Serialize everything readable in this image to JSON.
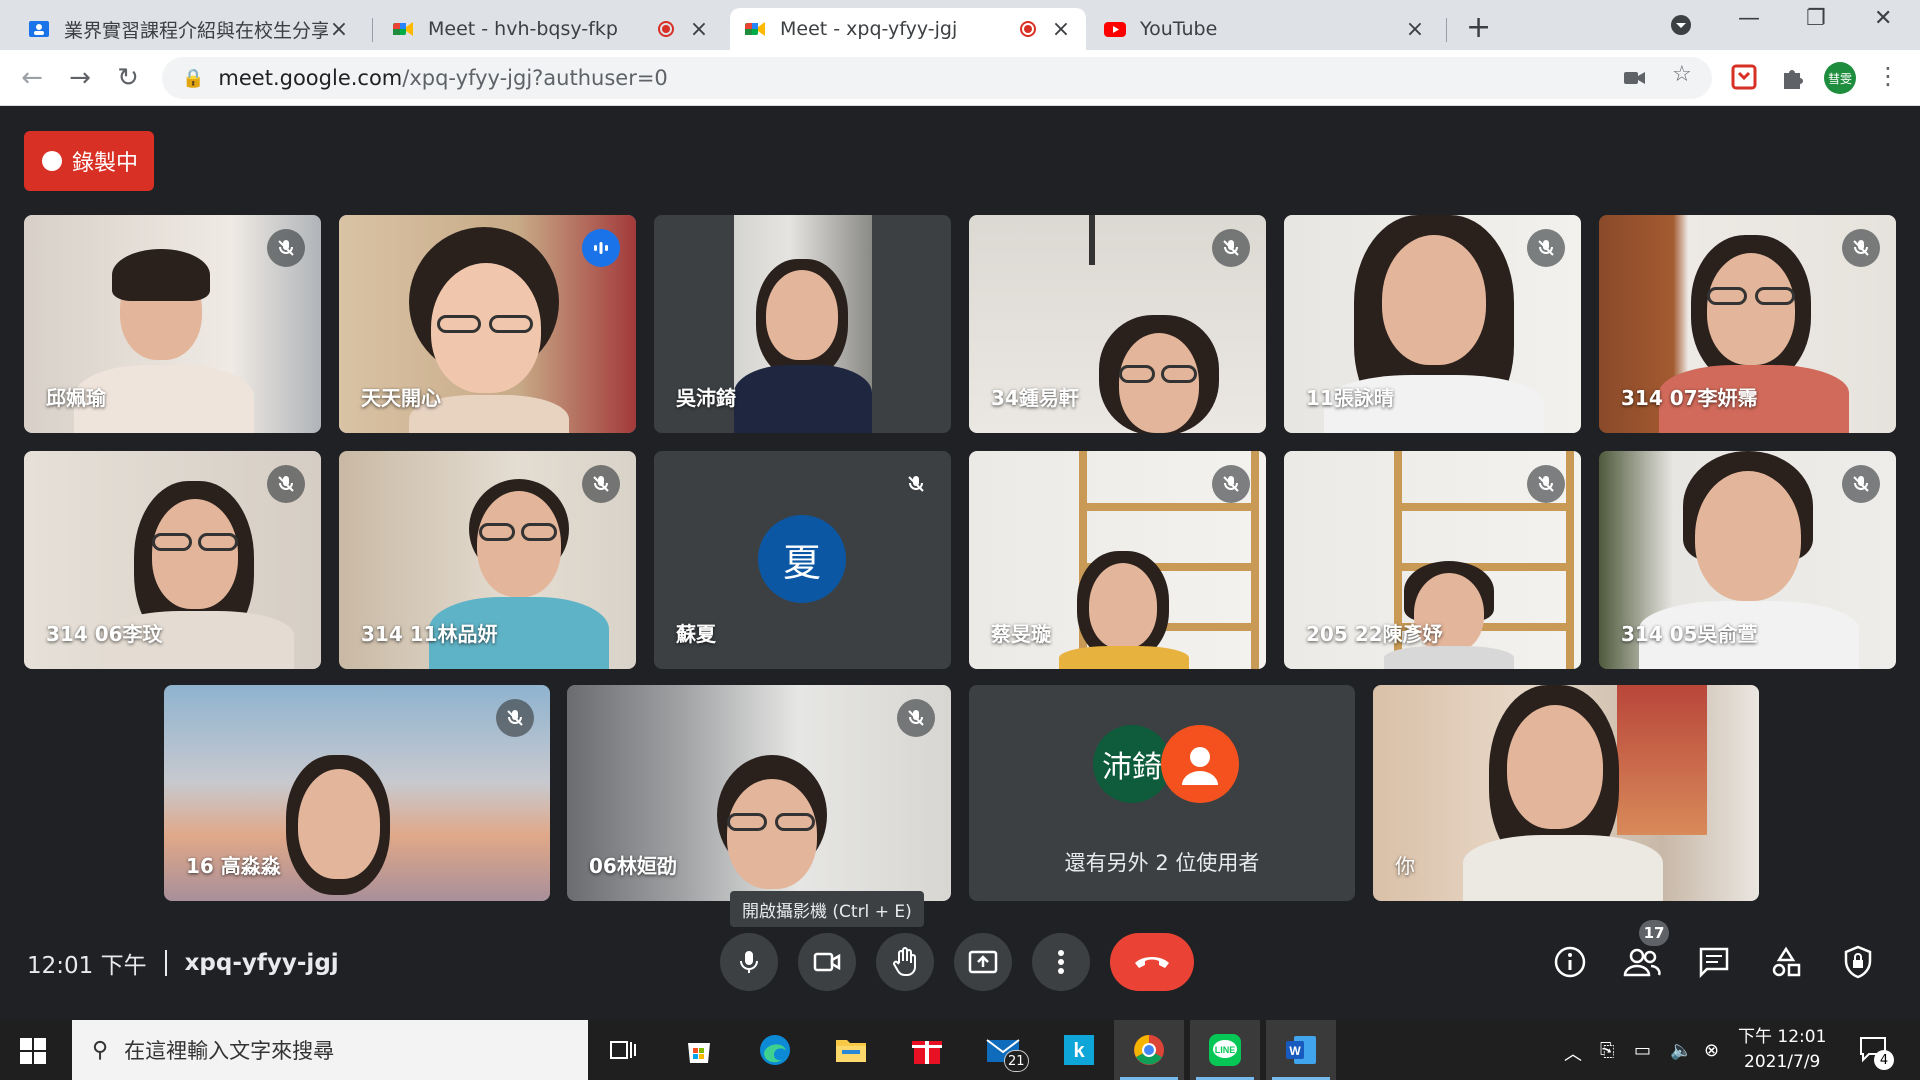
{
  "browser": {
    "tabs": [
      {
        "title": "業界實習課程介紹與在校生分享",
        "favicon": "classroom-icon",
        "active": false,
        "recording": false
      },
      {
        "title": "Meet - hvh-bqsy-fkp",
        "favicon": "meet-icon",
        "active": false,
        "recording": true
      },
      {
        "title": "Meet - xpq-yfyy-jgj",
        "favicon": "meet-icon",
        "active": true,
        "recording": true
      },
      {
        "title": "YouTube",
        "favicon": "youtube-icon",
        "active": false,
        "recording": false
      }
    ],
    "url_host": "meet.google.com",
    "url_path": "/xpq-yfyy-jgj?authuser=0",
    "profile_label": "彗雯"
  },
  "meet": {
    "recording_label": "錄製中",
    "participants": [
      {
        "name": "邱姵瑜",
        "muted": true
      },
      {
        "name": "天天開心",
        "muted": false,
        "speaking": true
      },
      {
        "name": "吳沛錡",
        "muted": false
      },
      {
        "name": "34鍾易軒",
        "muted": true
      },
      {
        "name": "11張詠晴",
        "muted": true
      },
      {
        "name": "314 07李妍霈",
        "muted": true
      },
      {
        "name": "314 06李玟",
        "muted": true
      },
      {
        "name": "314 11林品妍",
        "muted": true
      },
      {
        "name": "蘇夏",
        "muted": true,
        "avatar_letter": "夏"
      },
      {
        "name": "蔡旻璇",
        "muted": true
      },
      {
        "name": "205 22陳彥妤",
        "muted": true
      },
      {
        "name": "314 05吳俞萱",
        "muted": true
      },
      {
        "name": "16 高淼淼",
        "muted": true
      },
      {
        "name": "06林姮劭",
        "muted": true
      },
      {
        "name": "你",
        "muted": false
      }
    ],
    "others": {
      "avatar_text": "沛錡",
      "label": "還有另外 2 位使用者"
    },
    "time": "12:01 下午",
    "meeting_code": "xpq-yfyy-jgj",
    "tooltip": "開啟攝影機 (Ctrl + E)",
    "people_count": "17",
    "colors": {
      "end_call": "#ea4335",
      "recording": "#d93025",
      "speaking_outline": "#8ab4f8"
    }
  },
  "taskbar": {
    "search_placeholder": "在這裡輸入文字來搜尋",
    "mail_badge": "21",
    "clock_time": "下午 12:01",
    "clock_date": "2021/7/9",
    "notif_count": "4"
  }
}
